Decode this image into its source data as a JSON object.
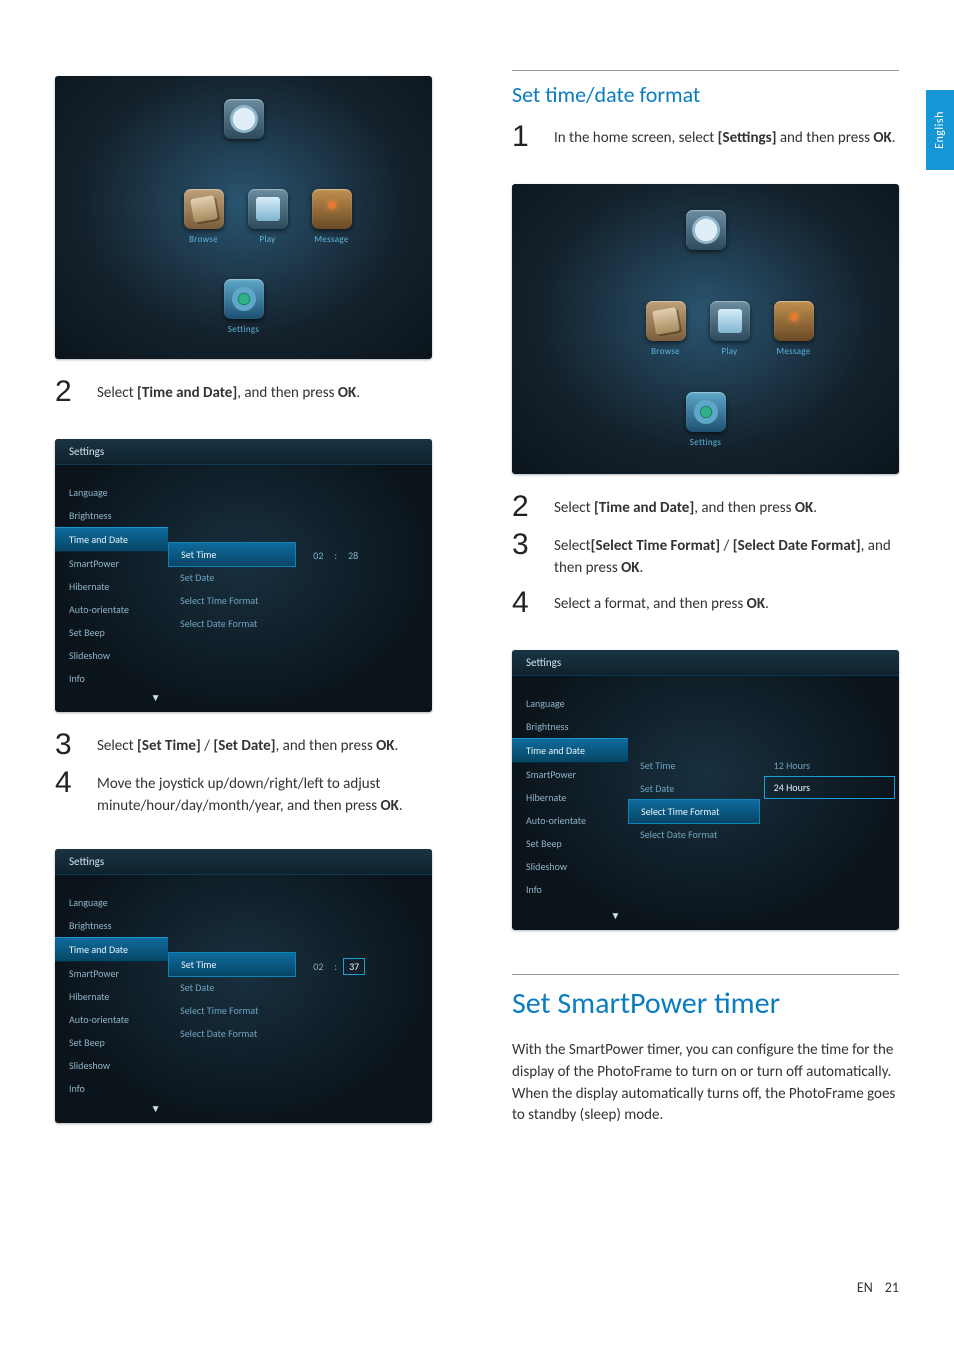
{
  "page": {
    "lang_code": "EN",
    "number": "21",
    "side_tab": "English"
  },
  "home": {
    "items": [
      "Clock",
      "Browse",
      "Play",
      "Message",
      "Settings"
    ]
  },
  "leftCol": {
    "step2": {
      "pre": "Select ",
      "bold": "[Time and Date]",
      "post": ", and then press ",
      "ok": "OK",
      "dot": "."
    },
    "step3": {
      "pre": "Select ",
      "b1": "[Set Time]",
      "mid": " / ",
      "b2": "[Set Date]",
      "post": ", and then press ",
      "ok": "OK",
      "dot": "."
    },
    "step4": {
      "l1": "Move the joystick up/down/right/left to adjust minute/hour/day/month/year, and then press ",
      "ok": "OK",
      "dot": "."
    },
    "settingsShot": {
      "title": "Settings",
      "sidebar": [
        "Language",
        "Brightness",
        "Time and Date",
        "SmartPower",
        "Hibernate",
        "Auto-orientate",
        "Set Beep",
        "Slideshow",
        "Info"
      ],
      "selectedIndex": 2,
      "mid": [
        "Set Time",
        "Set Date",
        "Select Time Format",
        "Select Date Format"
      ],
      "midSelectedIndex": 0,
      "time": {
        "hh": "02",
        "sep": ":",
        "mm": "28",
        "mmSel": "37"
      }
    }
  },
  "rightCol": {
    "subheading": "Set time/date format",
    "step1": {
      "pre": "In the home screen, select ",
      "b1": "[Settings]",
      "mid": " and then press ",
      "ok": "OK",
      "dot": "."
    },
    "step2": {
      "pre": "Select ",
      "bold": "[Time and Date]",
      "post": ", and then press ",
      "ok": "OK",
      "dot": "."
    },
    "step3": {
      "pre": "Select",
      "b1": "[Select Time Format]",
      "mid": " / ",
      "b2": "[Select Date Format]",
      "post": ", and then press ",
      "ok": "OK",
      "dot": "."
    },
    "step4": {
      "pre": "Select a format, and then press ",
      "ok": "OK",
      "dot": "."
    },
    "heading": "Set SmartPower timer",
    "body": "With the SmartPower timer, you can configure the time for the display of the PhotoFrame to turn on or turn off automatically. When the display automatically turns off, the PhotoFrame goes to standby (sleep) mode.",
    "formatShot": {
      "title": "Settings",
      "sidebar": [
        "Language",
        "Brightness",
        "Time and Date",
        "SmartPower",
        "Hibernate",
        "Auto-orientate",
        "Set Beep",
        "Slideshow",
        "Info"
      ],
      "selectedIndex": 2,
      "mid": [
        "Set Time",
        "Set Date",
        "Select Time Format",
        "Select Date Format"
      ],
      "midSelectedIndex": 2,
      "options": [
        "12 Hours",
        "24 Hours"
      ],
      "optSelectedIndex": 1
    }
  }
}
